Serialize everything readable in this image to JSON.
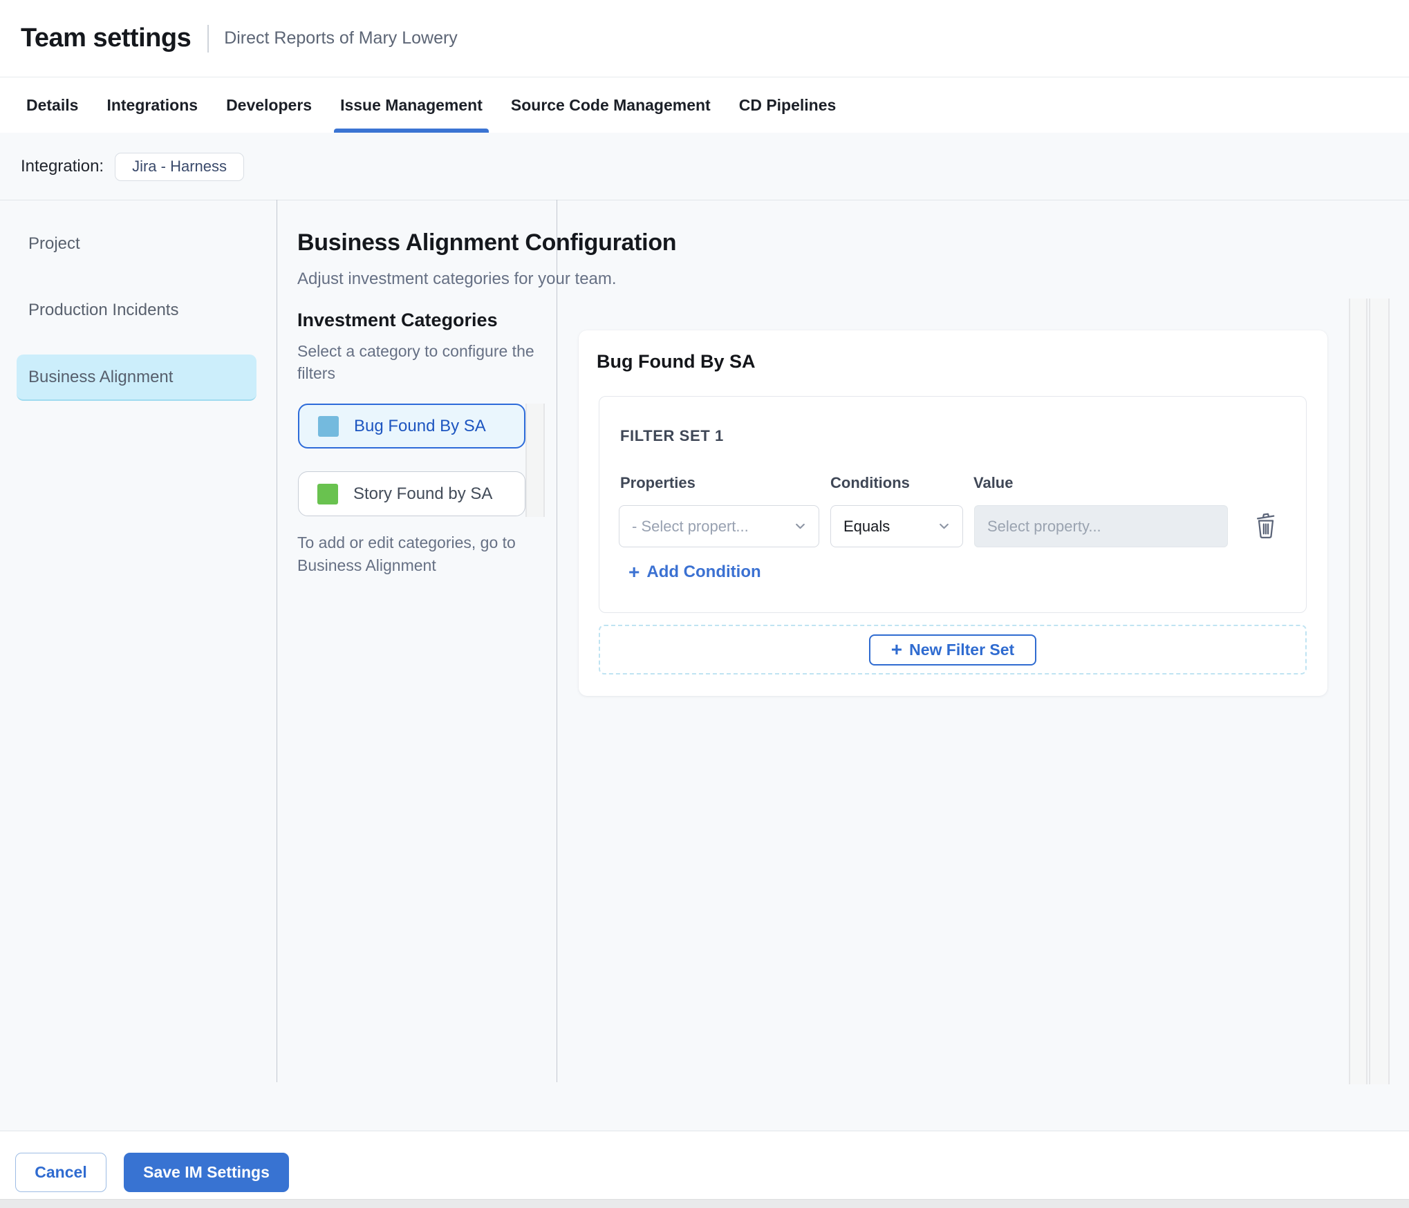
{
  "header": {
    "title": "Team settings",
    "subtitle": "Direct Reports of Mary Lowery"
  },
  "tabs": [
    {
      "label": "Details",
      "active": false
    },
    {
      "label": "Integrations",
      "active": false
    },
    {
      "label": "Developers",
      "active": false
    },
    {
      "label": "Issue Management",
      "active": true
    },
    {
      "label": "Source Code Management",
      "active": false
    },
    {
      "label": "CD Pipelines",
      "active": false
    }
  ],
  "integration": {
    "label": "Integration:",
    "chip": "Jira - Harness"
  },
  "sidebar": {
    "items": [
      {
        "label": "Project",
        "selected": false
      },
      {
        "label": "Production Incidents",
        "selected": false
      },
      {
        "label": "Business Alignment",
        "selected": true
      }
    ]
  },
  "main": {
    "title": "Business Alignment Configuration",
    "subtitle": "Adjust investment categories for your team.",
    "categories": {
      "heading": "Investment Categories",
      "hint": "Select a category to configure the filters",
      "items": [
        {
          "label": "Bug Found By SA",
          "color": "#74bade",
          "selected": true
        },
        {
          "label": "Story Found by SA",
          "color": "#69c24f",
          "selected": false
        }
      ],
      "footnote": "To add or edit categories, go to Business Alignment"
    },
    "panel": {
      "title": "Bug Found By SA",
      "filter_set": {
        "title": "FILTER SET 1",
        "columns": [
          "Properties",
          "Conditions",
          "Value"
        ],
        "property_placeholder": "- Select propert...",
        "condition_value": "Equals",
        "value_placeholder": "Select property...",
        "add_condition_label": "Add Condition"
      },
      "new_filter_set_label": "New Filter Set"
    }
  },
  "footer": {
    "cancel_label": "Cancel",
    "save_label": "Save IM Settings"
  },
  "colors": {
    "accent_blue": "#3b72d0",
    "selected_category_text": "#1d55c0",
    "sidebar_selected_bg": "#cceefb",
    "content_bg": "#f7f9fb",
    "bug_swatch": "#74bade",
    "story_swatch": "#69c24f"
  }
}
